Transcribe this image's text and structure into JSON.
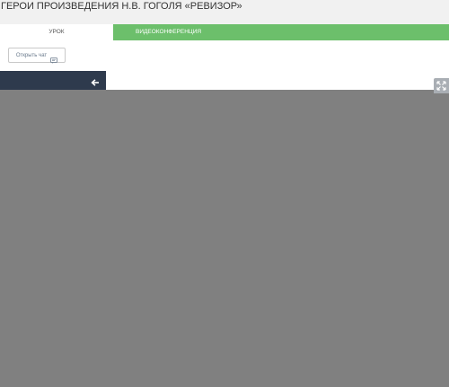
{
  "lesson": {
    "title": "ГЕРОИ ПРОИЗВЕДЕНИЯ Н.В. ГОГОЛЯ «РЕВИЗОР»"
  },
  "tabs": [
    {
      "label": "УРОК",
      "active": true
    },
    {
      "label": "ВИДЕОКОНФЕРЕНЦИЯ",
      "active": false
    }
  ],
  "chat_button": {
    "label": "Открыть чат",
    "icon": "chat-icon"
  },
  "sidebar": {
    "collapse_icon": "arrow-left-icon"
  },
  "viewer": {
    "expand_icon": "expand-icon"
  },
  "colors": {
    "tab_active_bg": "#ffffff",
    "tab_inactive_bg": "#6cbf6b",
    "sidebar_bg": "#2e3a4d",
    "overlay_bg": "#808080",
    "page_bg": "#f1f1f1"
  }
}
